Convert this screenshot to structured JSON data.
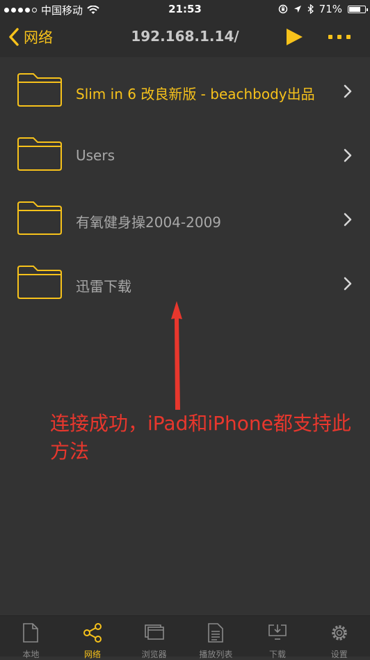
{
  "status_bar": {
    "carrier": "中国移动",
    "time": "21:53",
    "battery": "71%",
    "battery_level": 0.71
  },
  "nav": {
    "back_label": "网络",
    "title": "192.168.1.14/"
  },
  "folders": [
    {
      "name": "Slim in 6 改良新版 - beachbody出品",
      "highlighted": true
    },
    {
      "name": "Users",
      "highlighted": false
    },
    {
      "name": "有氧健身操2004-2009",
      "highlighted": false
    },
    {
      "name": "迅雷下载",
      "highlighted": false
    }
  ],
  "annotation": {
    "text": "连接成功，iPad和iPhone都支持此方法",
    "color": "#e8372d"
  },
  "tabs": [
    {
      "label": "本地",
      "icon": "document-icon",
      "active": false
    },
    {
      "label": "网络",
      "icon": "share-icon",
      "active": true
    },
    {
      "label": "浏览器",
      "icon": "browser-icon",
      "active": false
    },
    {
      "label": "播放列表",
      "icon": "playlist-icon",
      "active": false
    },
    {
      "label": "下载",
      "icon": "download-icon",
      "active": false
    },
    {
      "label": "设置",
      "icon": "gear-icon",
      "active": false
    }
  ],
  "colors": {
    "accent": "#f7c21b",
    "background": "#333333",
    "bar": "#2d2d2d"
  }
}
